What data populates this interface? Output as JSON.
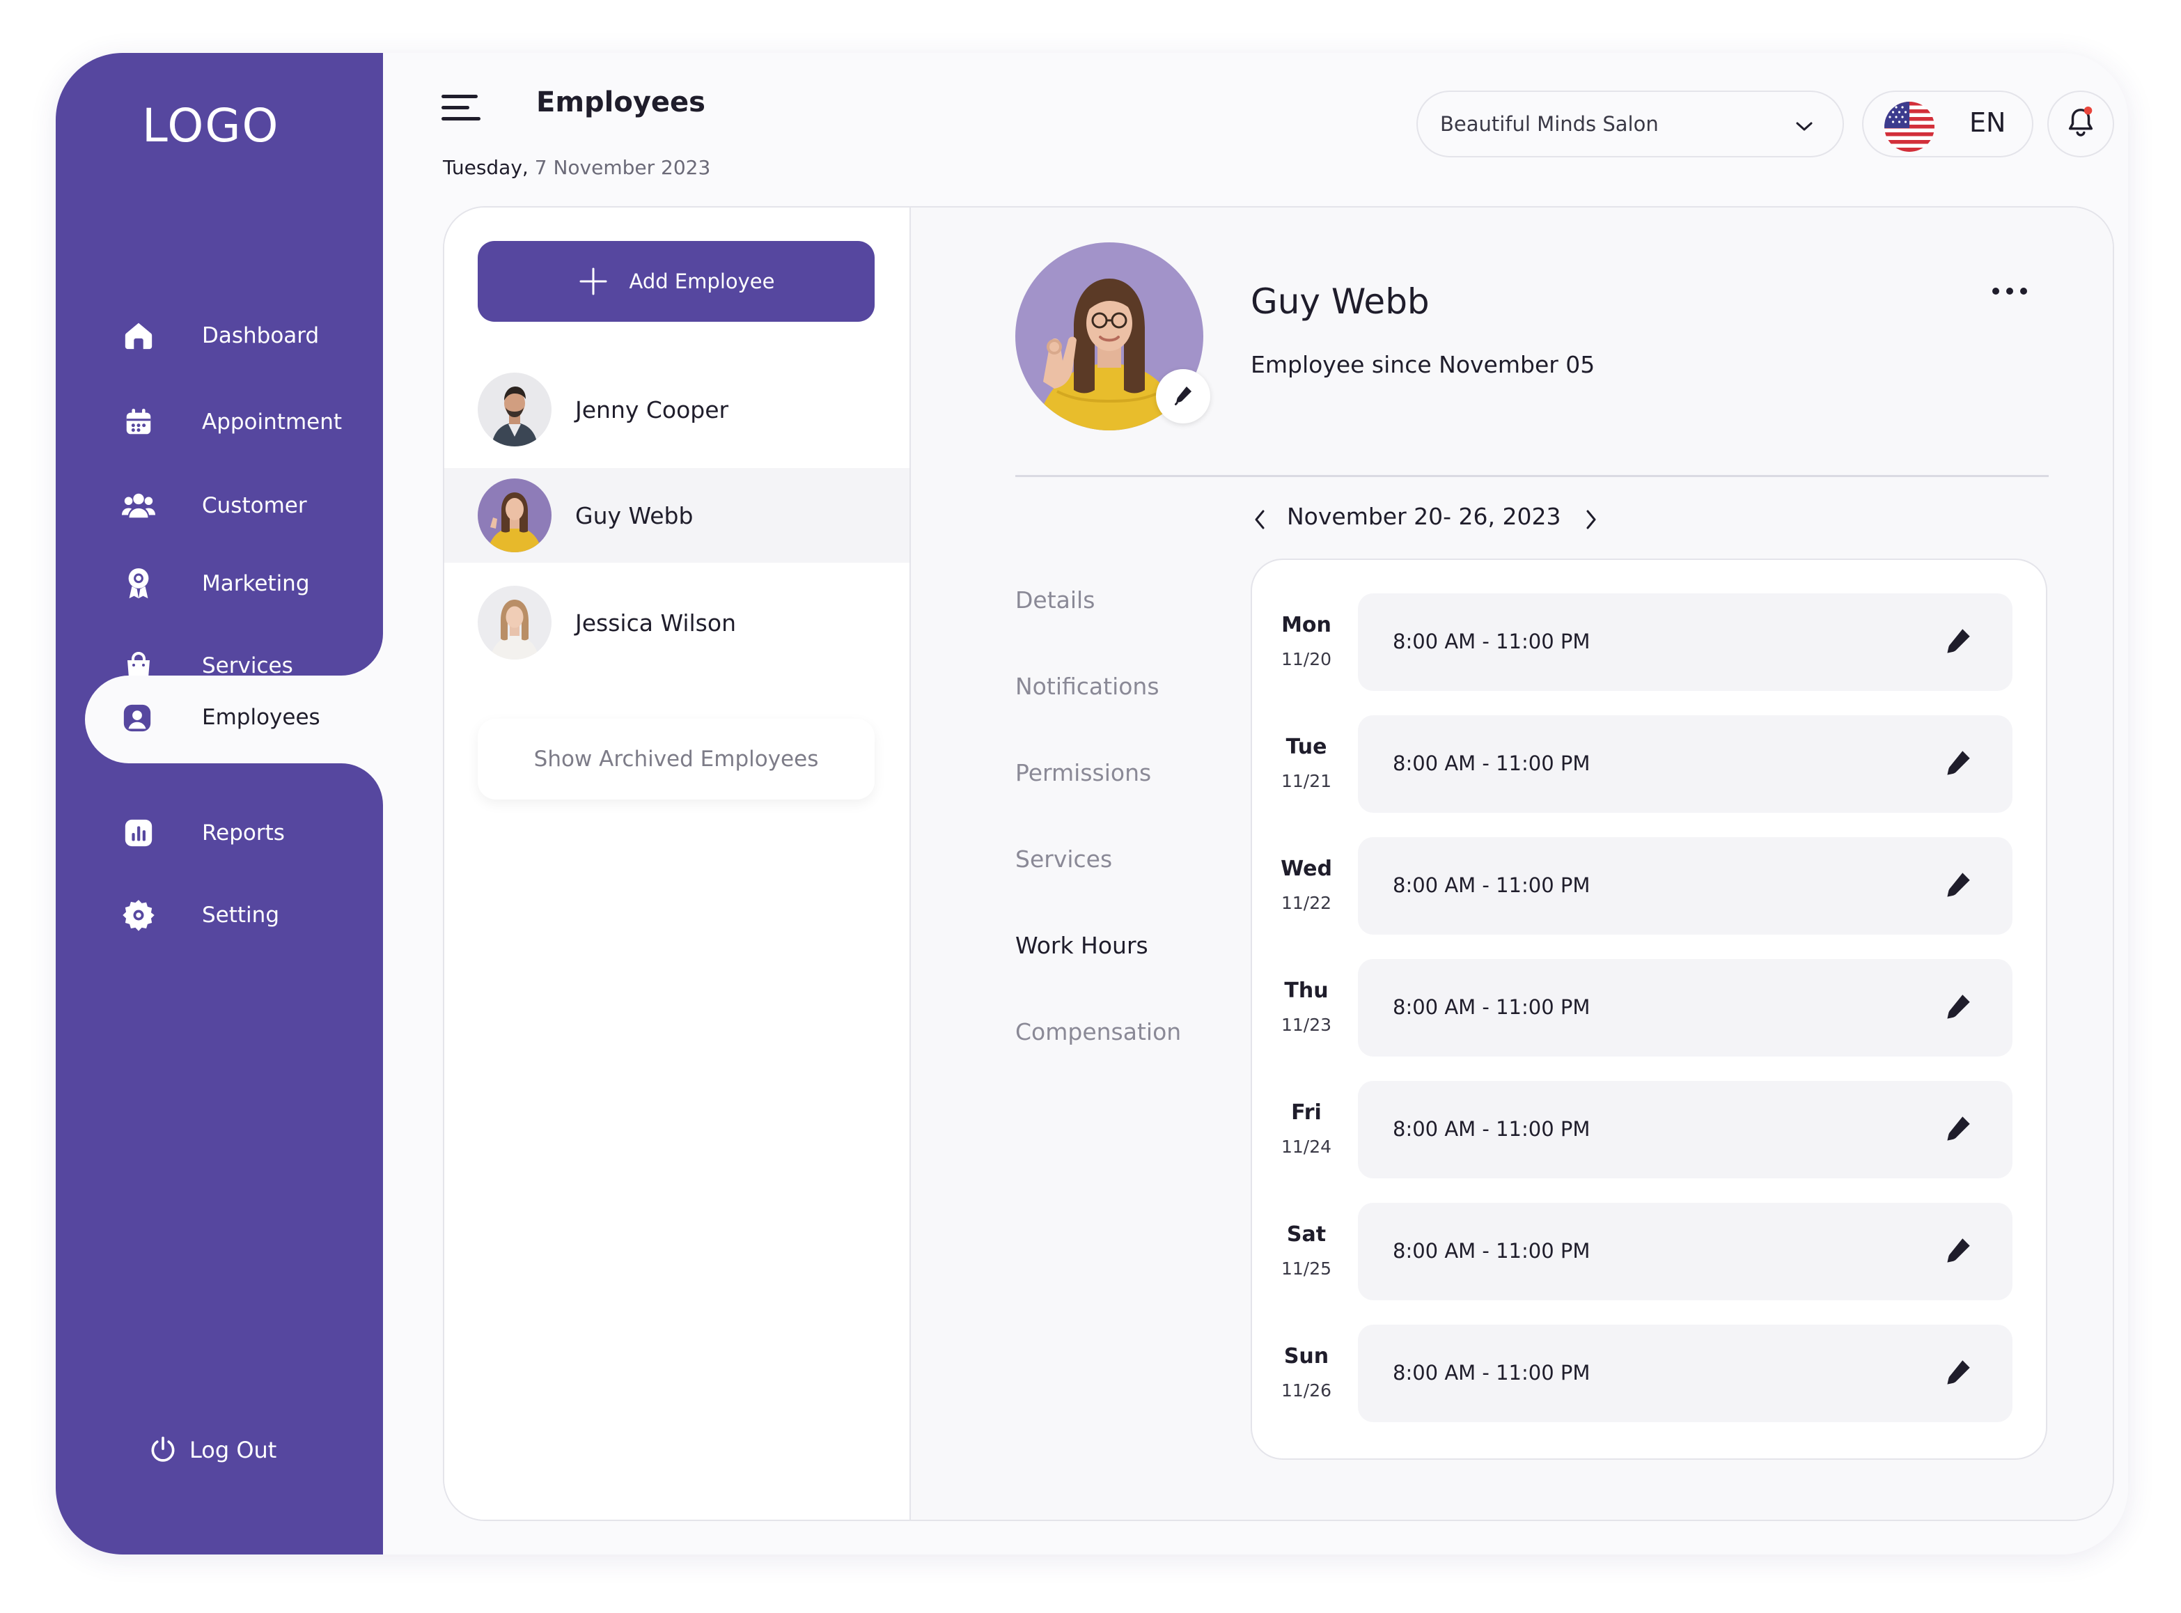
{
  "sidebar": {
    "logo": "LOGO",
    "items": [
      {
        "label": "Dashboard",
        "icon": "home-icon"
      },
      {
        "label": "Appointment",
        "icon": "calendar-icon"
      },
      {
        "label": "Customer",
        "icon": "users-icon"
      },
      {
        "label": "Marketing",
        "icon": "award-icon"
      },
      {
        "label": "Services",
        "icon": "shopping-bag-icon"
      },
      {
        "label": "Employees",
        "icon": "user-badge-icon",
        "active": true
      },
      {
        "label": "Reports",
        "icon": "bar-chart-icon"
      },
      {
        "label": "Setting",
        "icon": "gear-icon"
      }
    ],
    "logout": "Log Out"
  },
  "header": {
    "title": "Employees",
    "date_day": "Tuesday,",
    "date_rest": " 7 November 2023",
    "salon": "Beautiful Minds Salon",
    "language": "EN"
  },
  "employees": {
    "add_label": "Add Employee",
    "list": [
      {
        "name": "Jenny Cooper"
      },
      {
        "name": "Guy Webb",
        "active": true
      },
      {
        "name": "Jessica Wilson"
      }
    ],
    "archived_label": "Show Archived Employees"
  },
  "profile": {
    "name": "Guy Webb",
    "since": "Employee since November 05"
  },
  "tabs": [
    {
      "label": "Details"
    },
    {
      "label": "Notifications"
    },
    {
      "label": "Permissions"
    },
    {
      "label": "Services"
    },
    {
      "label": "Work Hours",
      "active": true
    },
    {
      "label": "Compensation"
    }
  ],
  "week": {
    "label": "November 20- 26, 2023"
  },
  "work_hours": [
    {
      "day": "Mon",
      "date": "11/20",
      "time": "8:00 AM - 11:00 PM"
    },
    {
      "day": "Tue",
      "date": "11/21",
      "time": "8:00 AM - 11:00 PM"
    },
    {
      "day": "Wed",
      "date": "11/22",
      "time": "8:00 AM - 11:00 PM"
    },
    {
      "day": "Thu",
      "date": "11/23",
      "time": "8:00 AM - 11:00 PM"
    },
    {
      "day": "Fri",
      "date": "11/24",
      "time": "8:00 AM - 11:00 PM"
    },
    {
      "day": "Sat",
      "date": "11/25",
      "time": "8:00 AM - 11:00 PM"
    },
    {
      "day": "Sun",
      "date": "11/26",
      "time": "8:00 AM - 11:00 PM"
    }
  ],
  "colors": {
    "brand": "#56479f",
    "text": "#1f1d2b",
    "muted": "#8a8996",
    "notification_dot": "#e8453c"
  }
}
